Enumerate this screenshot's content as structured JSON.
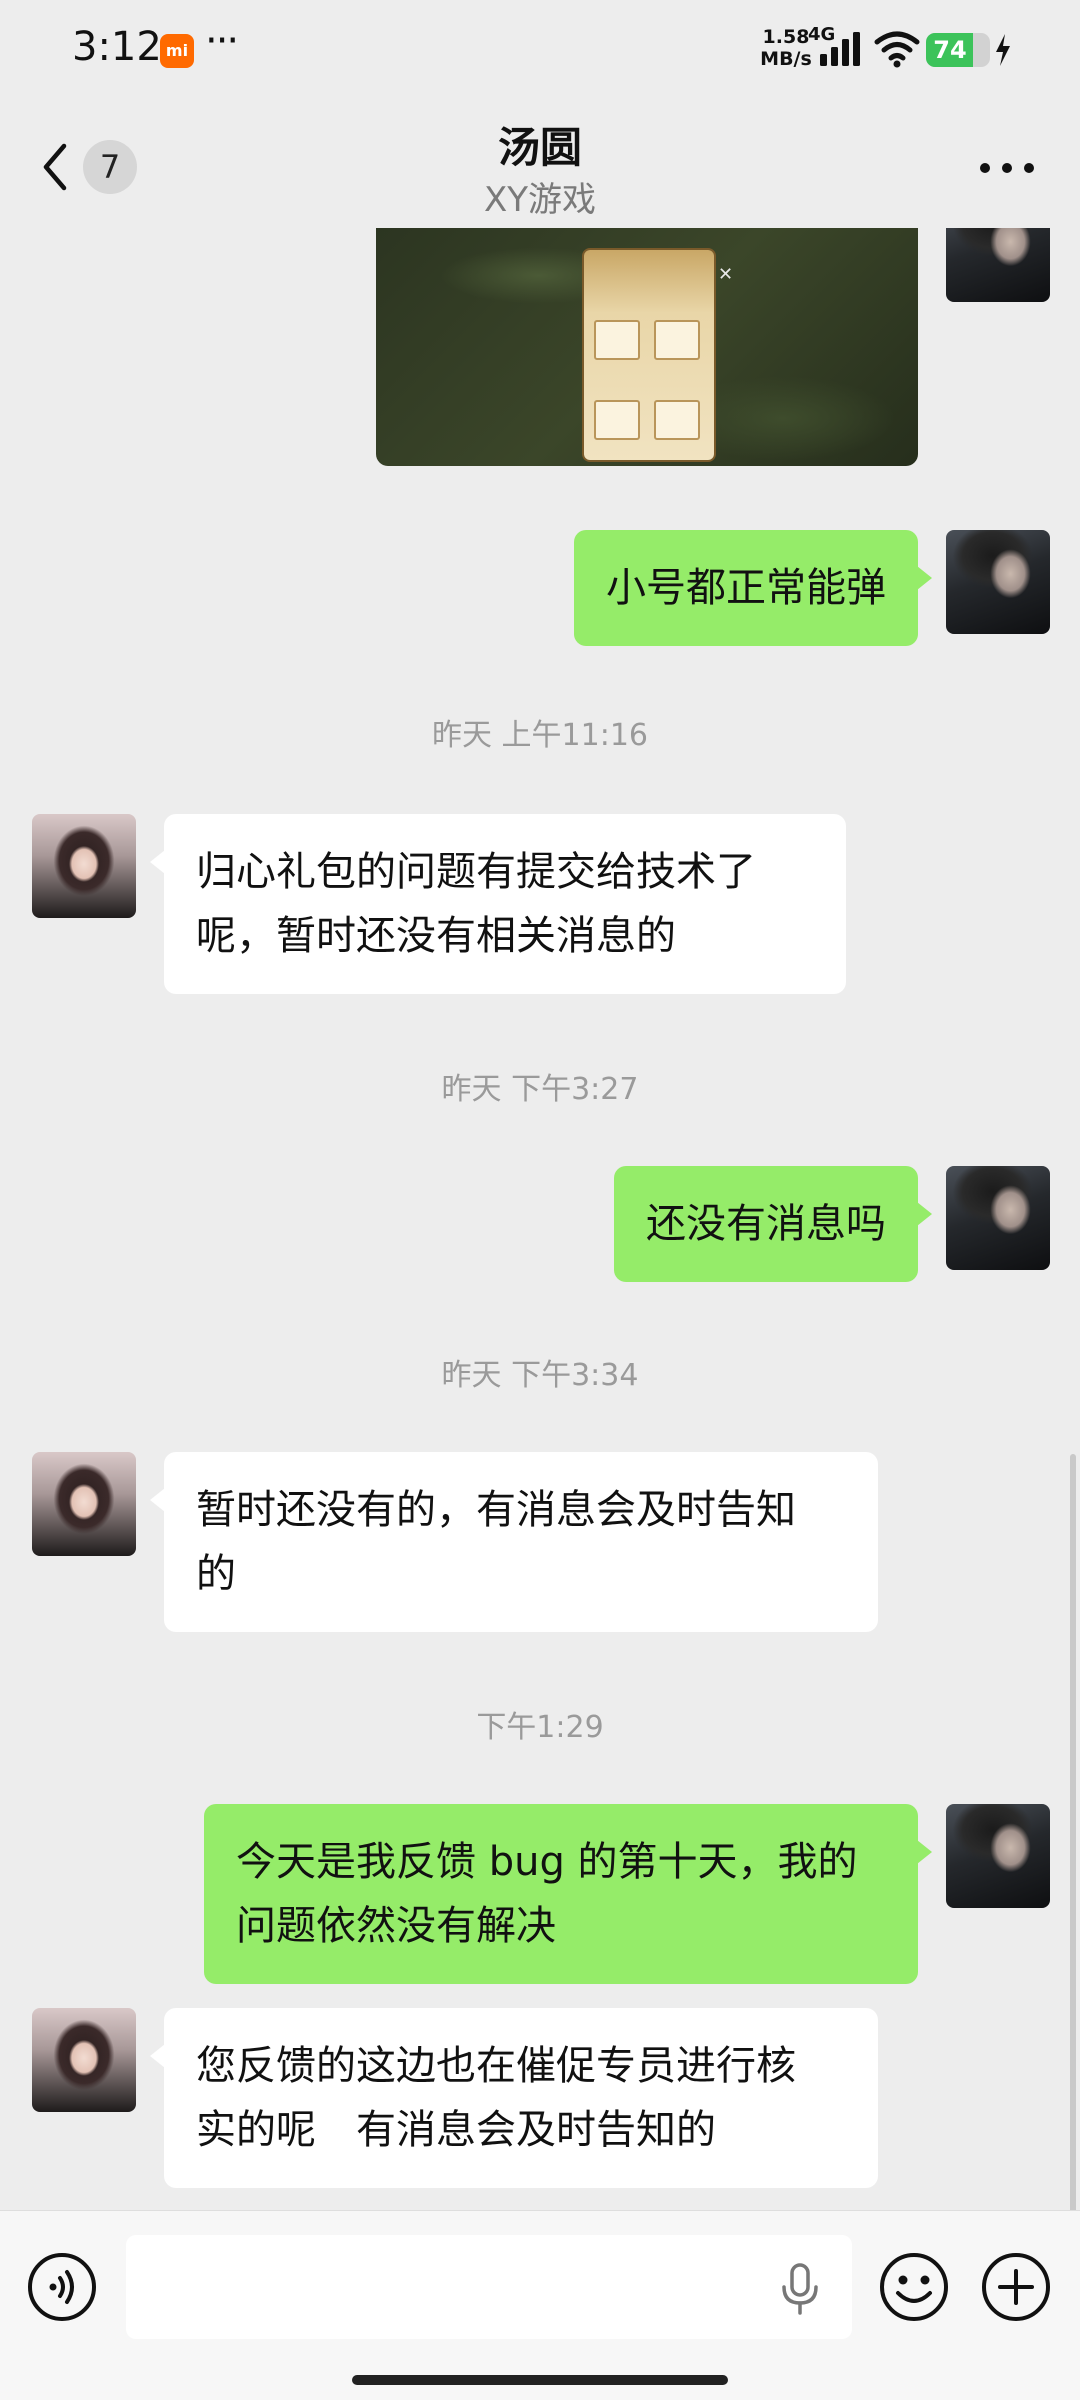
{
  "status_bar": {
    "time": "3:12",
    "carrier_badge": "mi",
    "more_dots": "···",
    "net_speed_value": "1.58",
    "net_speed_unit": "MB/s",
    "network_type": "4G",
    "battery_level": "74",
    "battery_fraction": 0.74,
    "icons": [
      "signal-icon",
      "wifi-icon",
      "charging-icon"
    ]
  },
  "header": {
    "unread_count": "7",
    "title": "汤圆",
    "subtitle": "XY游戏",
    "icons": [
      "back-icon",
      "more-icon"
    ]
  },
  "messages": [
    {
      "type": "image",
      "direction": "outgoing",
      "description_icon": "game-screenshot-image"
    },
    {
      "type": "text",
      "direction": "outgoing",
      "text": "小号都正常能弹"
    },
    {
      "type": "timestamp",
      "text": "昨天 上午11:16"
    },
    {
      "type": "text",
      "direction": "incoming",
      "line1": "归心礼包的问题有提交给技术了",
      "line2": "呢，暂时还没有相关消息的"
    },
    {
      "type": "timestamp",
      "text": "昨天 下午3:27"
    },
    {
      "type": "text",
      "direction": "outgoing",
      "text": "还没有消息吗"
    },
    {
      "type": "timestamp",
      "text": "昨天 下午3:34"
    },
    {
      "type": "text",
      "direction": "incoming",
      "line1": "暂时还没有的，有消息会及时告知",
      "line2": "的"
    },
    {
      "type": "timestamp",
      "text": "下午1:29"
    },
    {
      "type": "text",
      "direction": "outgoing",
      "line1": "今天是我反馈 bug 的第十天，我的",
      "line2": "问题依然没有解决"
    },
    {
      "type": "text",
      "direction": "incoming",
      "line1": "您反馈的这边也在催促专员进行核",
      "line2": "实的呢　有消息会及时告知的"
    }
  ],
  "input_bar": {
    "placeholder": "",
    "value": "",
    "icons": [
      "voice-icon",
      "mic-icon",
      "emoji-icon",
      "plus-icon"
    ]
  },
  "colors": {
    "background": "#ededed",
    "outgoing_bubble": "#95ec69",
    "incoming_bubble": "#ffffff",
    "timestamp_text": "#9a9a9a",
    "battery": "#3cc35a",
    "mi_badge": "#ff6a00"
  }
}
